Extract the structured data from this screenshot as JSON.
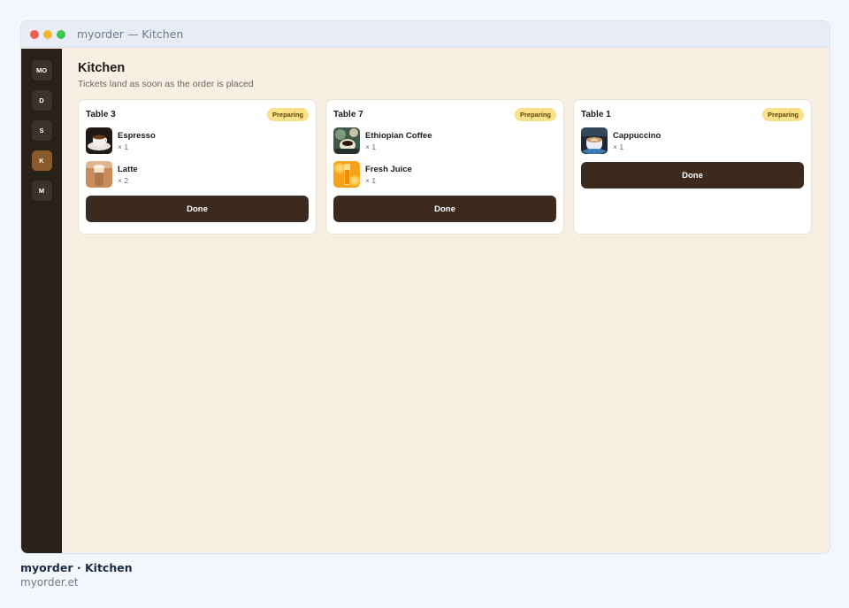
{
  "window": {
    "title": "myorder — Kitchen"
  },
  "rail": {
    "items": [
      {
        "label": "MO"
      },
      {
        "label": "D"
      },
      {
        "label": "S"
      },
      {
        "label": "K",
        "active": true
      },
      {
        "label": "M"
      }
    ]
  },
  "page": {
    "title": "Kitchen",
    "subtitle": "Tickets land as soon as the order is placed"
  },
  "tickets": [
    {
      "table": "Table 3",
      "status": "Preparing",
      "items": [
        {
          "name": "Espresso",
          "qty": "× 1",
          "icon": "espresso-photo"
        },
        {
          "name": "Latte",
          "qty": "× 2",
          "icon": "latte-photo"
        }
      ],
      "action": "Done"
    },
    {
      "table": "Table 7",
      "status": "Preparing",
      "items": [
        {
          "name": "Ethiopian Coffee",
          "qty": "× 1",
          "icon": "ethiopian-coffee-photo"
        },
        {
          "name": "Fresh Juice",
          "qty": "× 1",
          "icon": "fresh-juice-photo"
        }
      ],
      "action": "Done"
    },
    {
      "table": "Table 1",
      "status": "Preparing",
      "items": [
        {
          "name": "Cappuccino",
          "qty": "× 1",
          "icon": "cappuccino-photo"
        }
      ],
      "action": "Done"
    }
  ],
  "footer": {
    "title": "myorder · Kitchen",
    "url": "myorder.et"
  },
  "colors": {
    "rail_bg": "#2b211b",
    "rail_active": "#8a5a2e",
    "canvas_bg": "#f7efe4",
    "button_bg": "#3d2a1f",
    "badge_bg": "#fbe08a"
  }
}
